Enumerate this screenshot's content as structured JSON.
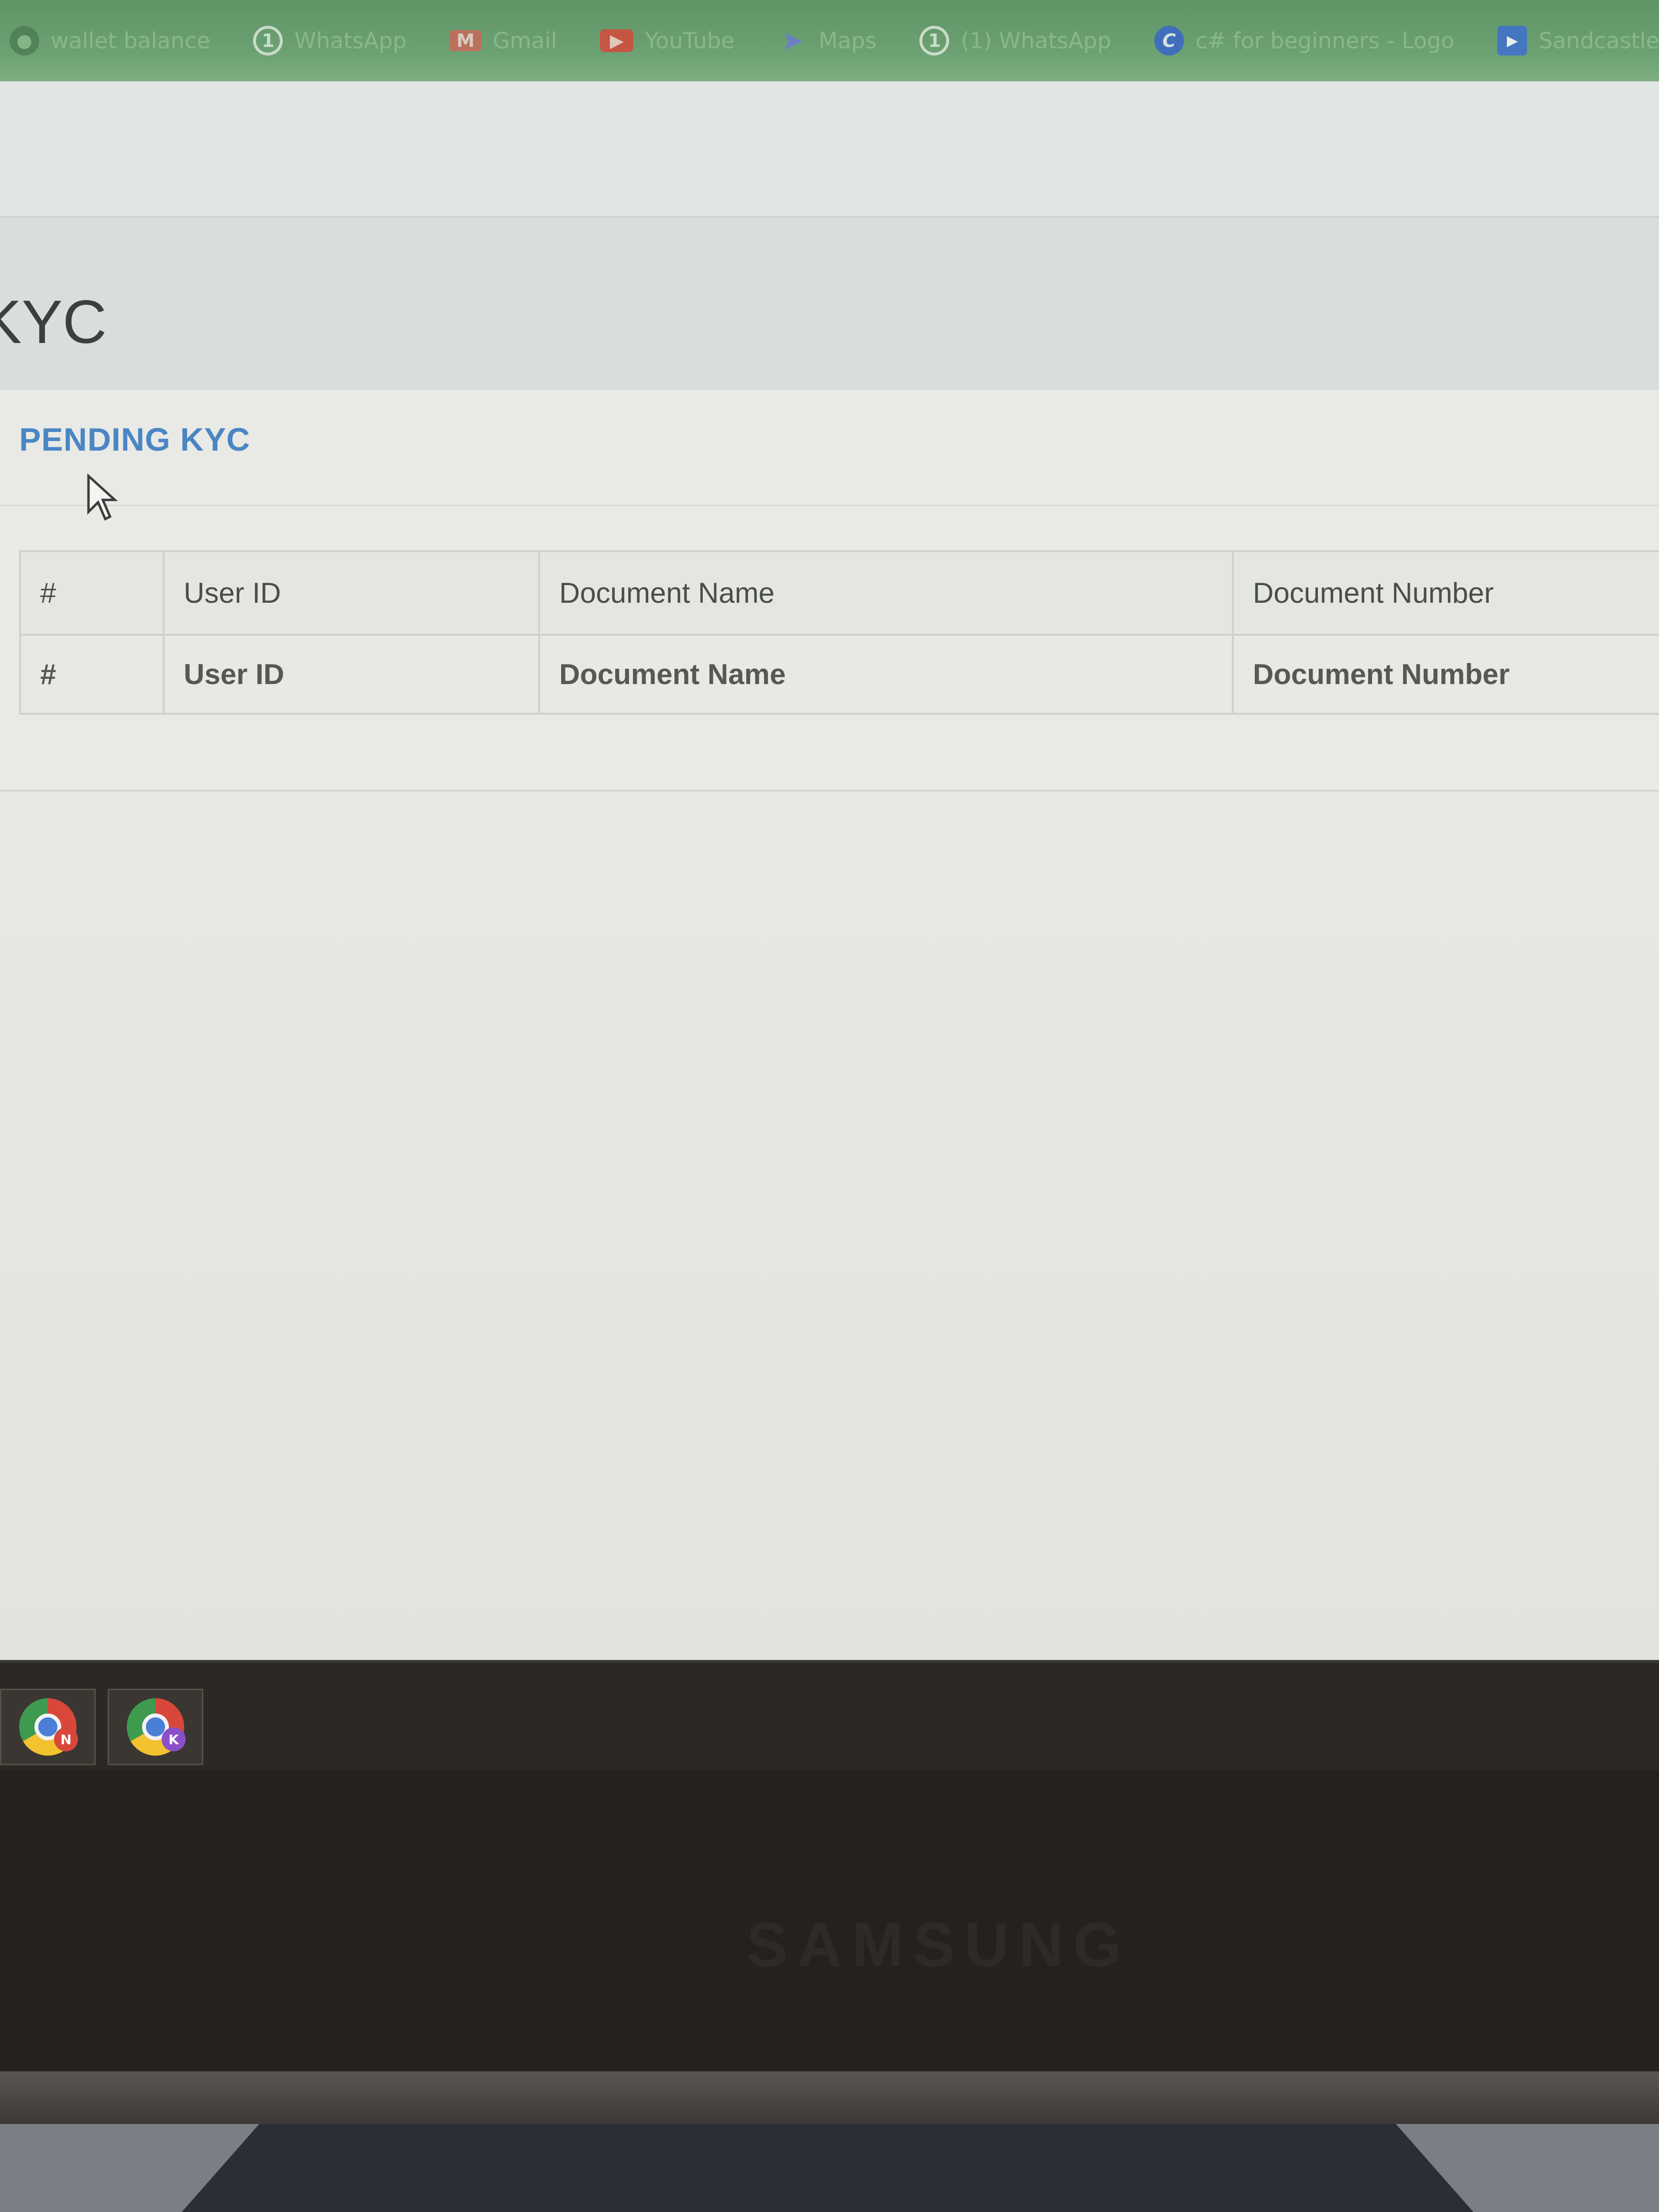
{
  "bookmarks": [
    {
      "icon": "globe-icon",
      "label": "wallet balance"
    },
    {
      "icon": "number-1-icon",
      "label": "WhatsApp"
    },
    {
      "icon": "gmail-icon",
      "label": "Gmail"
    },
    {
      "icon": "youtube-icon",
      "label": "YouTube"
    },
    {
      "icon": "maps-icon",
      "label": "Maps"
    },
    {
      "icon": "number-1-icon",
      "label": "(1) WhatsApp"
    },
    {
      "icon": "c-icon",
      "label": "c# for beginners - Logo"
    },
    {
      "icon": "play-icon",
      "label": "Sandcastle"
    }
  ],
  "page": {
    "title": "KYC"
  },
  "card": {
    "title": "PENDING KYC"
  },
  "table": {
    "headers": [
      "#",
      "User ID",
      "Document Name",
      "Document Number"
    ],
    "rows": [
      [
        "#",
        "User ID",
        "Document Name",
        "Document Number"
      ]
    ]
  },
  "taskbar": {
    "apps": [
      {
        "icon": "chrome-icon",
        "badge": "N",
        "badge_color": "#d9473b"
      },
      {
        "icon": "chrome-icon",
        "badge": "K",
        "badge_color": "#8a4fc9"
      }
    ]
  },
  "monitor": {
    "brand": "SAMSUNG"
  },
  "colors": {
    "bookmarks_bar": "#6da374",
    "card_title": "#4a86c4",
    "table_border": "#cfd1cc",
    "taskbar": "#2c2824"
  }
}
